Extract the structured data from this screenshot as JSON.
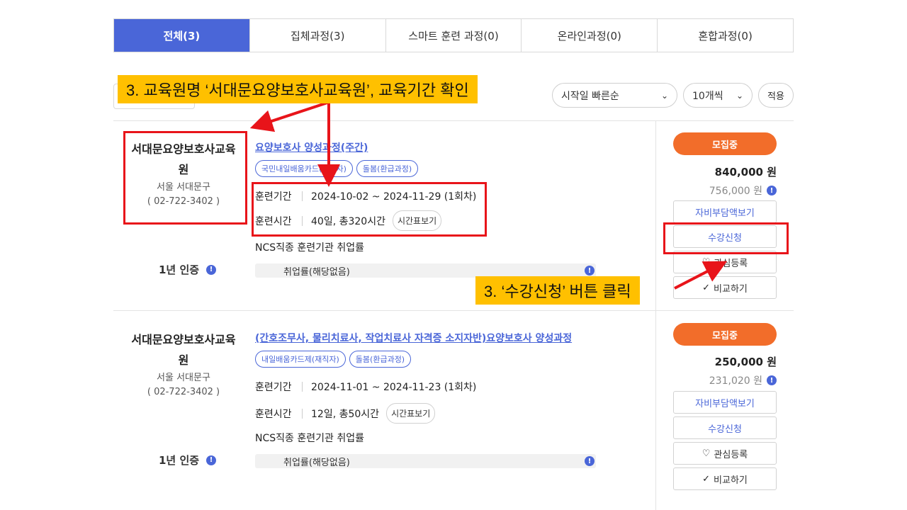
{
  "tabs": [
    {
      "label": "전체(3)",
      "active": true
    },
    {
      "label": "집체과정(3)",
      "active": false
    },
    {
      "label": "스마트 훈련 과정(0)",
      "active": false
    },
    {
      "label": "온라인과정(0)",
      "active": false
    },
    {
      "label": "혼합과정(0)",
      "active": false
    }
  ],
  "filters": {
    "sort_value": "시작일 빠른순",
    "count_value": "10개씩",
    "apply_label": "적용"
  },
  "courses": [
    {
      "institution": "서대문요양보호사교육원",
      "location": "서울 서대문구",
      "phone": "( 02-722-3402 )",
      "cert_label": "1년 인증",
      "title": "요양보호사 양성과정(주간)",
      "tags": [
        "국민내일배움카드(구직자)",
        "돌봄(환급과정)"
      ],
      "period_label": "훈련기간",
      "period": "2024-10-02 ~ 2024-11-29 (1회차)",
      "hours_label": "훈련시간",
      "hours": "40일, 총320시간",
      "timetable_label": "시간표보기",
      "ncs_label": "NCS직종 훈련기관 취업률",
      "employment": "취업률(해당없음)",
      "status": "모집중",
      "price": "840,000 원",
      "self_price": "756,000 원",
      "btn_self": "자비부담액보기",
      "btn_apply": "수강신청",
      "btn_interest": "관심등록",
      "btn_compare": "비교하기"
    },
    {
      "institution": "서대문요양보호사교육원",
      "location": "서울 서대문구",
      "phone": "( 02-722-3402 )",
      "cert_label": "1년 인증",
      "title": "(간호조무사, 물리치료사, 작업치료사 자격증 소지자반)요양보호사 양성과정",
      "tags": [
        "내일배움카드제(재직자)",
        "돌봄(환급과정)"
      ],
      "period_label": "훈련기간",
      "period": "2024-11-01 ~ 2024-11-23 (1회차)",
      "hours_label": "훈련시간",
      "hours": "12일, 총50시간",
      "timetable_label": "시간표보기",
      "ncs_label": "NCS직종 훈련기관 취업률",
      "employment": "취업률(해당없음)",
      "status": "모집중",
      "price": "250,000 원",
      "self_price": "231,020 원",
      "btn_self": "자비부담액보기",
      "btn_apply": "수강신청",
      "btn_interest": "관심등록",
      "btn_compare": "비교하기"
    }
  ],
  "annotations": {
    "callout_top": "3. 교육원명 ‘서대문요양보호사교육원’, 교육기간 확인",
    "callout_bottom": "3. ‘수강신청’ 버튼 클릭",
    "highlight_color": "#e8141a",
    "callout_color": "#ffc000"
  },
  "colors": {
    "accent": "#4a66d8",
    "status": "#f26d2a"
  }
}
